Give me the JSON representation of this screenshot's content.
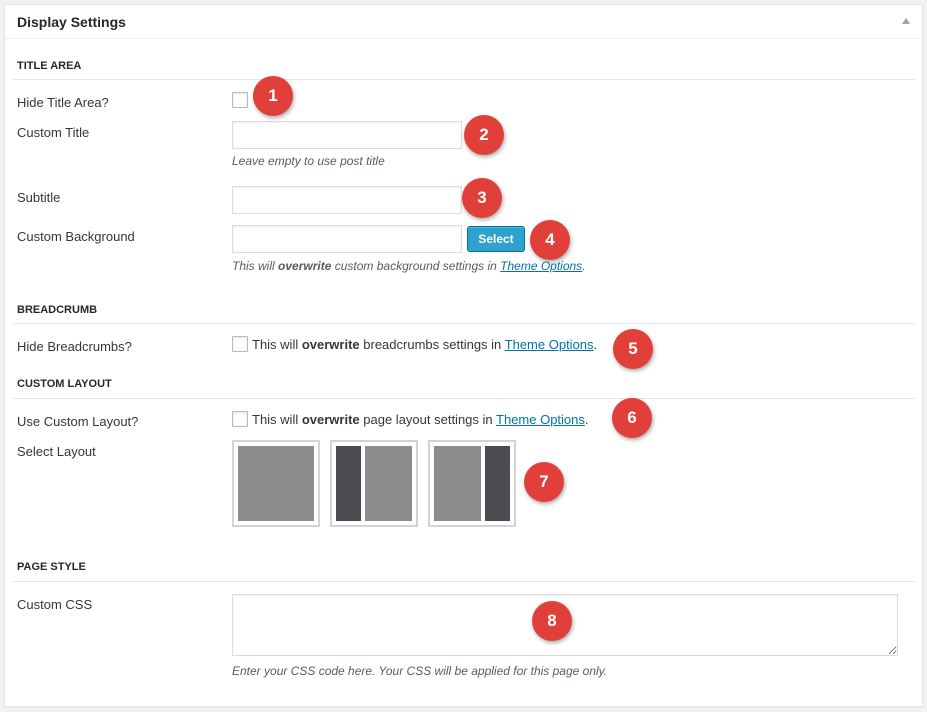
{
  "panel": {
    "title": "Display Settings"
  },
  "sections": {
    "title_area": "TITLE AREA",
    "breadcrumb": "BREADCRUMB",
    "custom_layout": "CUSTOM LAYOUT",
    "page_style": "PAGE STYLE"
  },
  "title_area": {
    "hide_label": "Hide Title Area?",
    "hide_checked": false,
    "custom_title_label": "Custom Title",
    "custom_title_value": "",
    "custom_title_hint": "Leave empty to use post title",
    "subtitle_label": "Subtitle",
    "subtitle_value": "",
    "bg_label": "Custom Background",
    "bg_value": "",
    "select_label": "Select",
    "bg_hint_pre": "This will ",
    "bg_hint_bold": "overwrite",
    "bg_hint_mid": " custom background settings in ",
    "bg_hint_link": "Theme Options",
    "bg_hint_post": "."
  },
  "breadcrumb": {
    "hide_label": "Hide Breadcrumbs?",
    "hide_checked": false,
    "text_pre": "This will ",
    "text_bold": "overwrite",
    "text_mid": " breadcrumbs settings in ",
    "text_link": "Theme Options",
    "text_post": "."
  },
  "custom_layout": {
    "use_label": "Use Custom Layout?",
    "use_checked": false,
    "text_pre": "This will ",
    "text_bold": "overwrite",
    "text_mid": " page layout settings in ",
    "text_link": "Theme Options",
    "text_post": ".",
    "select_label": "Select Layout",
    "options": [
      "full-width",
      "left-sidebar",
      "right-sidebar"
    ]
  },
  "page_style": {
    "css_label": "Custom CSS",
    "css_value": "",
    "css_hint": "Enter your CSS code here. Your CSS will be applied for this page only."
  },
  "badges": [
    "1",
    "2",
    "3",
    "4",
    "5",
    "6",
    "7",
    "8"
  ],
  "colors": {
    "badge": "#e13f3a",
    "button": "#2ea2cc",
    "link": "#0073aa",
    "layout_light": "#8d8d8d",
    "layout_dark": "#4a4c52"
  }
}
